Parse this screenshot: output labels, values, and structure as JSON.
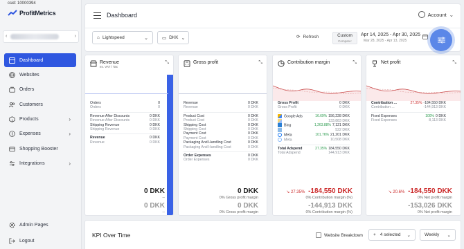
{
  "csid": "csid: 10000394",
  "brand": {
    "name": "ProfitMetrics"
  },
  "nav": {
    "items": [
      {
        "label": "Dashboard",
        "icon": "dashboard-icon",
        "active": true
      },
      {
        "label": "Websites",
        "icon": "globe-icon"
      },
      {
        "label": "Orders",
        "icon": "orders-icon"
      },
      {
        "label": "Customers",
        "icon": "customers-icon"
      },
      {
        "label": "Products",
        "icon": "products-icon",
        "chevron": "›"
      },
      {
        "label": "Expenses",
        "icon": "expenses-icon",
        "chevron": "›"
      },
      {
        "label": "Shopping Booster",
        "icon": "booster-icon"
      },
      {
        "label": "Integrations",
        "icon": "integrations-icon",
        "chevron": "›"
      }
    ],
    "admin": "Admin Pages",
    "logout": "Logout"
  },
  "header": {
    "title": "Dashboard",
    "account": "Account",
    "source_select": "Lightspeed",
    "currency_select": "DKK",
    "refresh": "Refresh",
    "custom": "Custom",
    "compare": "Compare:",
    "date_range": "Apr 14, 2025 - Apr 30, 2025",
    "compare_range": "Mar 28, 2025 - Apr 13, 2025"
  },
  "kpis": {
    "revenue": {
      "title": "Revenue",
      "subtitle": "ex. VAT / Tax",
      "rows": [
        [
          [
            "Orders",
            "0",
            ""
          ],
          [
            "Orders",
            "0",
            "sub"
          ]
        ],
        [
          [
            "Revenue After Discounts",
            "0 DKK",
            ""
          ],
          [
            "Revenue After Discounts",
            "0 DKK",
            "sub"
          ],
          [
            "Shipping Revenue",
            "0 DKK",
            ""
          ],
          [
            "Shipping Revenue",
            "0 DKK",
            "sub"
          ]
        ],
        [
          [
            "Revenue",
            "0 DKK",
            "bold"
          ],
          [
            "Revenue",
            "0 DKK",
            "sub"
          ]
        ]
      ],
      "value": "0 DKK",
      "prev_value": "0 DKK",
      "dash1": "--",
      "dash2": "--"
    },
    "gross_profit": {
      "title": "Gross profit",
      "rows": [
        [
          [
            "Revenue",
            "0 DKK",
            ""
          ],
          [
            "Revenue",
            "0 DKK",
            "sub"
          ]
        ],
        [
          [
            "Product Cost",
            "0 DKK",
            ""
          ],
          [
            "Product Cost",
            "0 DKK",
            "sub"
          ],
          [
            "Shipping Cost",
            "0 DKK",
            ""
          ],
          [
            "Shipping Cost",
            "0 DKK",
            "sub"
          ],
          [
            "Payment Cost",
            "0 DKK",
            ""
          ],
          [
            "Payment Cost",
            "0 DKK",
            "sub"
          ],
          [
            "Packaging And Handling Cost",
            "0 DKK",
            ""
          ],
          [
            "Packaging And Handling Cost",
            "0 DKK",
            "sub"
          ]
        ],
        [
          [
            "Order Expenses",
            "0 DKK",
            "bold"
          ],
          [
            "Order Expenses",
            "0 DKK",
            "sub"
          ]
        ]
      ],
      "value": "0 DKK",
      "note": "0% Gross profit margin",
      "prev_value": "0 DKK",
      "prev_note": "0% Gross profit margin"
    },
    "contribution": {
      "title": "Contribution margin",
      "gross_profit": "Gross Profit",
      "gross_profit_v": "0 DKK",
      "gross_profit_sub_v": "0 DKK",
      "ads": [
        {
          "name": "Google Ads",
          "pct": "16.69%",
          "dir": "up",
          "value": "156,228 DKK",
          "prev": "133,883 DKK"
        },
        {
          "name": "Bing",
          "pct": "1,263.88%",
          "dir": "up",
          "value": "7,121 DKK",
          "prev": "522 DKK"
        },
        {
          "name": "Meta",
          "pct": "101.76%",
          "dir": "up",
          "value": "21,201 DKK",
          "prev": "10,508 DKK"
        }
      ],
      "total_label": "Total Adspend",
      "total_pct": "27.35%",
      "total_value": "184,550 DKK",
      "total_prev": "144,913 DKK",
      "delta": "27.35%",
      "value": "-184,550 DKK",
      "note": "0% Contribution margin (%)",
      "prev_value": "-144,913 DKK",
      "prev_note": "0% Contribution margin (%)"
    },
    "net_profit": {
      "title": "Net profit",
      "contribution_label": "Contribution ...",
      "contribution_pct": "27.35%",
      "contribution_value": "-184,550 DKK",
      "contribution_prev": "-144,913 DKK",
      "fixed_label": "Fixed Expenses",
      "fixed_pct": "100%",
      "fixed_value": "0 DKK",
      "fixed_prev": "8,113 DKK",
      "delta": "20.6%",
      "value": "-184,550 DKK",
      "note": "0% Net profit margin",
      "prev_value": "-153,026 DKK",
      "prev_note": "0% Net profit margin"
    }
  },
  "kpi_over_time": {
    "title": "KPI Over Time",
    "breakdown": "Website Breakdown",
    "selected": "4 selected",
    "add": "+",
    "period": "Weekly"
  },
  "colors": {
    "accent": "#2f57e0",
    "filter_button": "#5b87e8",
    "negative": "#cc2b2b",
    "positive": "#2a9a4d"
  }
}
